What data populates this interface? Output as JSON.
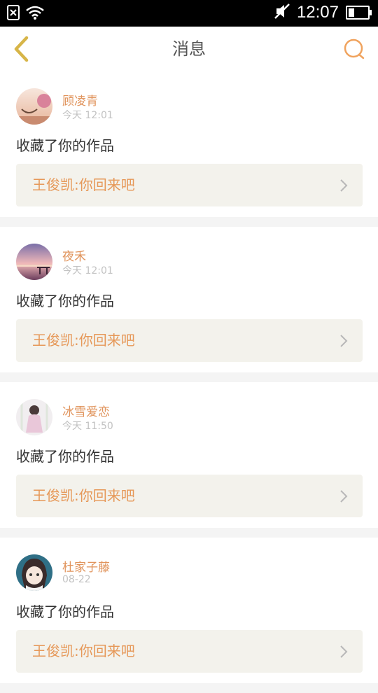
{
  "status_bar": {
    "time": "12:07",
    "icons": [
      "sim-blocked-icon",
      "wifi-icon",
      "mute-icon",
      "battery-icon"
    ]
  },
  "header": {
    "title": "消息",
    "back_icon": "chevron-left-icon",
    "search_icon": "search-icon"
  },
  "colors": {
    "accent": "#e0935b",
    "link_bg": "#f3f2ec",
    "back_arrow": "#d7b548"
  },
  "messages": [
    {
      "username": "顾凌青",
      "time": "今天  12:01",
      "action": "收藏了你的作品",
      "work": "王俊凯:你回来吧"
    },
    {
      "username": "夜禾",
      "time": "今天  12:01",
      "action": "收藏了你的作品",
      "work": "王俊凯:你回来吧"
    },
    {
      "username": "冰雪爱恋",
      "time": "今天  11:50",
      "action": "收藏了你的作品",
      "work": "王俊凯:你回来吧"
    },
    {
      "username": "杜家子藤",
      "time": "08-22",
      "action": "收藏了你的作品",
      "work": "王俊凯:你回来吧"
    }
  ]
}
